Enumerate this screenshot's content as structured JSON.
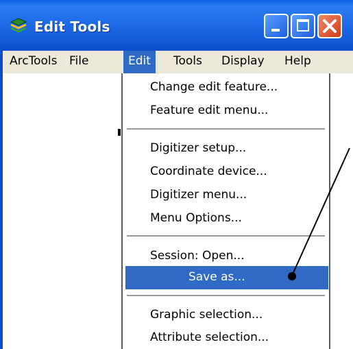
{
  "window": {
    "title": "Edit Tools",
    "icon": "layers-icon",
    "controls": [
      "minimize-icon",
      "maximize-icon",
      "close-icon"
    ]
  },
  "menubar": {
    "items": [
      {
        "label": "ArcTools"
      },
      {
        "label": "File"
      },
      {
        "label": "Edit",
        "active": true
      },
      {
        "label": "Tools"
      },
      {
        "label": "Display"
      },
      {
        "label": "Help"
      }
    ]
  },
  "edit_menu": {
    "groups": [
      [
        "Change edit feature...",
        "Feature edit menu..."
      ],
      [
        "Digitizer setup...",
        "Coordinate device...",
        "Digitizer menu...",
        "Menu Options..."
      ],
      [
        "Session:  Open...",
        "Save as..."
      ],
      [
        "Graphic selection...",
        "Attribute selection..."
      ]
    ],
    "highlighted_item": "Save as..."
  },
  "colors": {
    "titlebar": "#0d4dc8",
    "menubar": "#ece9d8",
    "highlight": "#316ac5",
    "close_button": "#d03a12"
  },
  "annotation": {
    "type": "callout-line-with-dot",
    "points_to": "Save as..."
  }
}
